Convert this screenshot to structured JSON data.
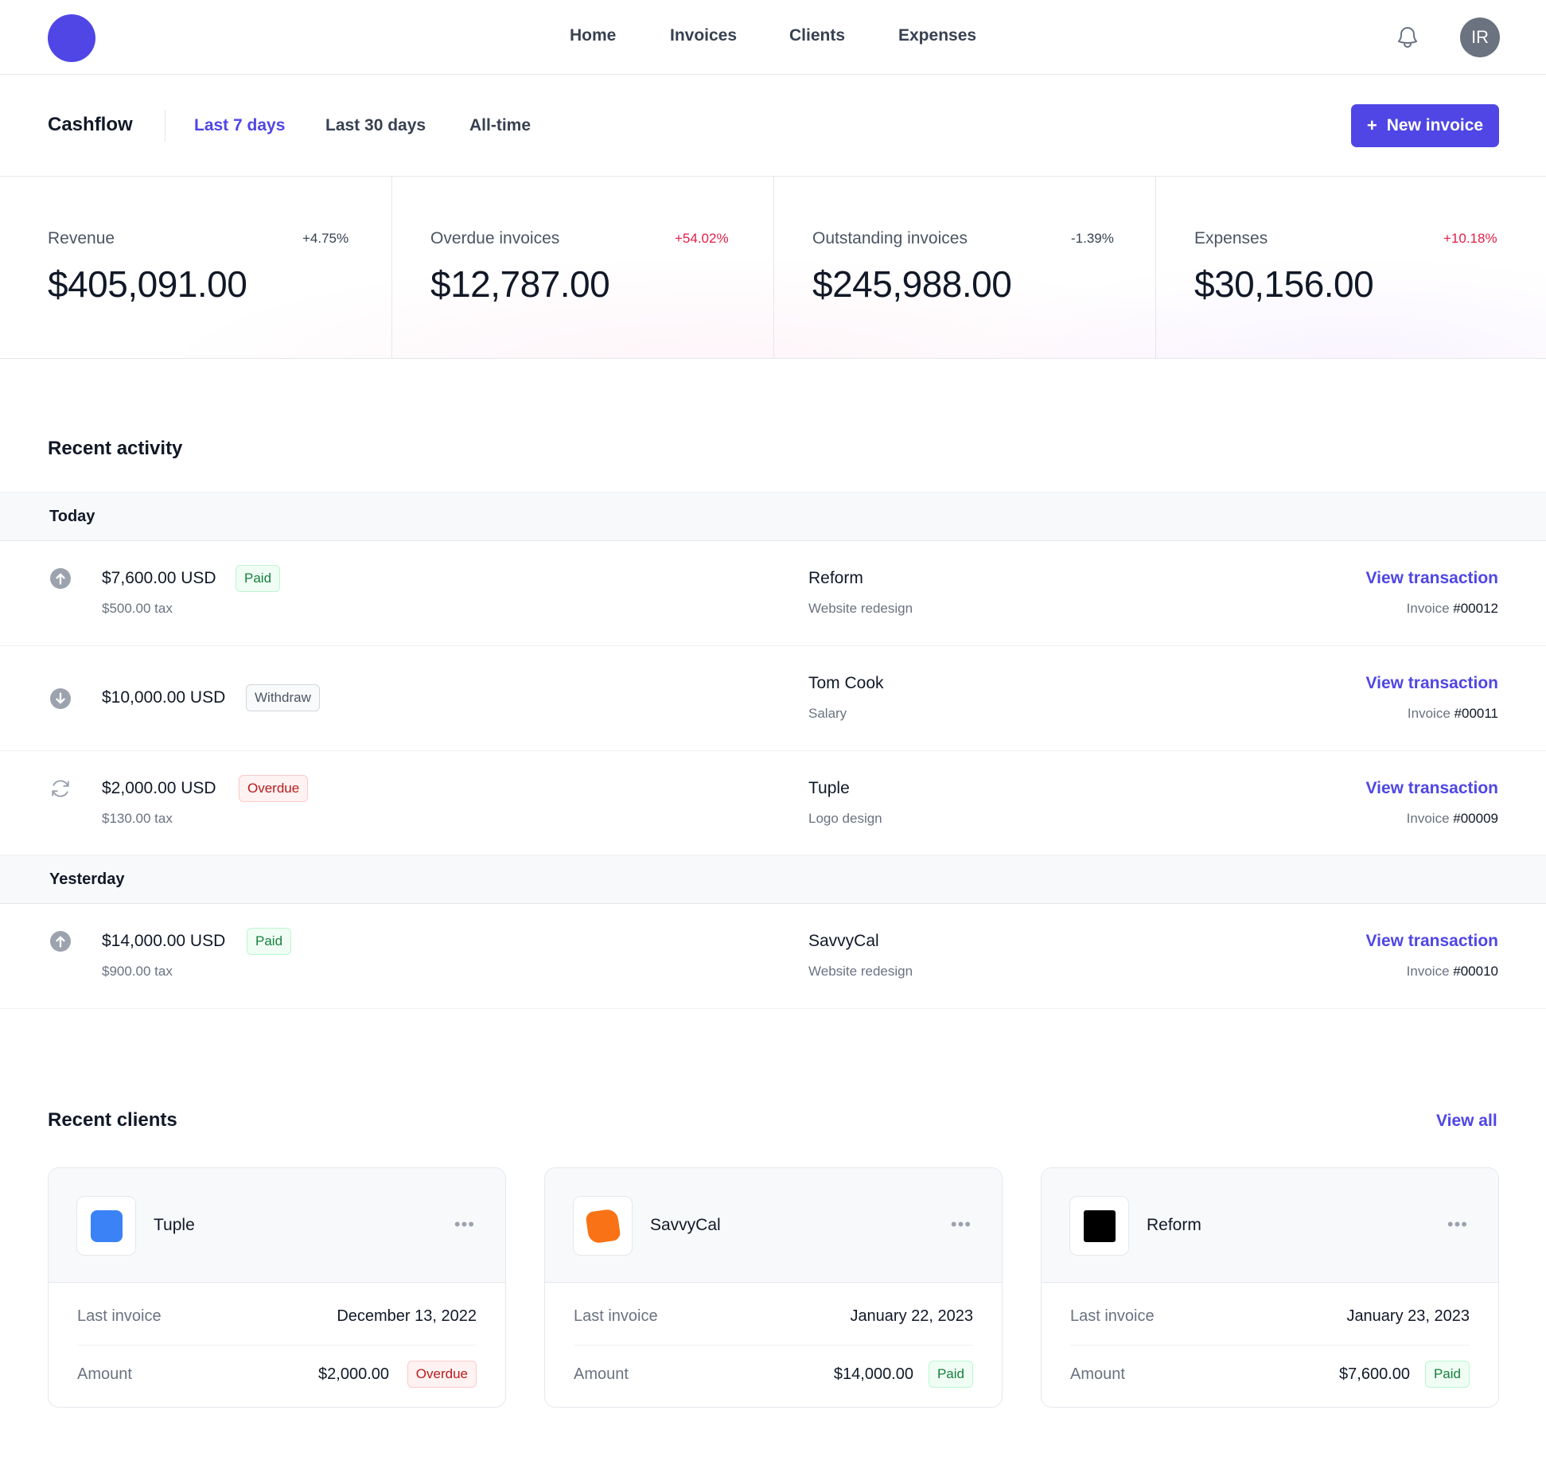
{
  "nav": {
    "items": [
      "Home",
      "Invoices",
      "Clients",
      "Expenses"
    ],
    "avatar_initials": "IR"
  },
  "subheader": {
    "title": "Cashflow",
    "periods": [
      "Last 7 days",
      "Last 30 days",
      "All-time"
    ],
    "active_period": "Last 7 days",
    "new_invoice_label": "New invoice"
  },
  "stats": [
    {
      "label": "Revenue",
      "change": "+4.75%",
      "value": "$405,091.00",
      "change_color": "#374151"
    },
    {
      "label": "Overdue invoices",
      "change": "+54.02%",
      "value": "$12,787.00",
      "change_color": "#e11d48"
    },
    {
      "label": "Outstanding invoices",
      "change": "-1.39%",
      "value": "$245,988.00",
      "change_color": "#374151"
    },
    {
      "label": "Expenses",
      "change": "+10.18%",
      "value": "$30,156.00",
      "change_color": "#e11d48"
    }
  ],
  "activity": {
    "title": "Recent activity",
    "groups": [
      {
        "day": "Today",
        "rows": [
          {
            "icon": "arrow-up-circle-icon",
            "amount": "$7,600.00 USD",
            "status": "Paid",
            "tax": "$500.00 tax",
            "client": "Reform",
            "description": "Website redesign",
            "action": "View transaction",
            "invoice_label": "Invoice",
            "invoice_number": "#00012"
          },
          {
            "icon": "arrow-down-circle-icon",
            "amount": "$10,000.00 USD",
            "status": "Withdraw",
            "tax": "",
            "client": "Tom Cook",
            "description": "Salary",
            "action": "View transaction",
            "invoice_label": "Invoice",
            "invoice_number": "#00011"
          },
          {
            "icon": "refresh-icon",
            "amount": "$2,000.00 USD",
            "status": "Overdue",
            "tax": "$130.00 tax",
            "client": "Tuple",
            "description": "Logo design",
            "action": "View transaction",
            "invoice_label": "Invoice",
            "invoice_number": "#00009"
          }
        ]
      },
      {
        "day": "Yesterday",
        "rows": [
          {
            "icon": "arrow-up-circle-icon",
            "amount": "$14,000.00 USD",
            "status": "Paid",
            "tax": "$900.00 tax",
            "client": "SavvyCal",
            "description": "Website redesign",
            "action": "View transaction",
            "invoice_label": "Invoice",
            "invoice_number": "#00010"
          }
        ]
      }
    ]
  },
  "clients": {
    "title": "Recent clients",
    "view_all": "View all",
    "last_invoice_label": "Last invoice",
    "amount_label": "Amount",
    "cards": [
      {
        "name": "Tuple",
        "logo_color": "#3b82f6",
        "last_invoice": "December 13, 2022",
        "amount": "$2,000.00",
        "status": "Overdue"
      },
      {
        "name": "SavvyCal",
        "logo_color": "#f97316",
        "last_invoice": "January 22, 2023",
        "amount": "$14,000.00",
        "status": "Paid"
      },
      {
        "name": "Reform",
        "logo_color": "#000000",
        "last_invoice": "January 23, 2023",
        "amount": "$7,600.00",
        "status": "Paid"
      }
    ]
  },
  "colors": {
    "accent": "#4f46e5",
    "paid": "#15803d",
    "overdue": "#b91c1c",
    "negative_change": "#e11d48"
  }
}
